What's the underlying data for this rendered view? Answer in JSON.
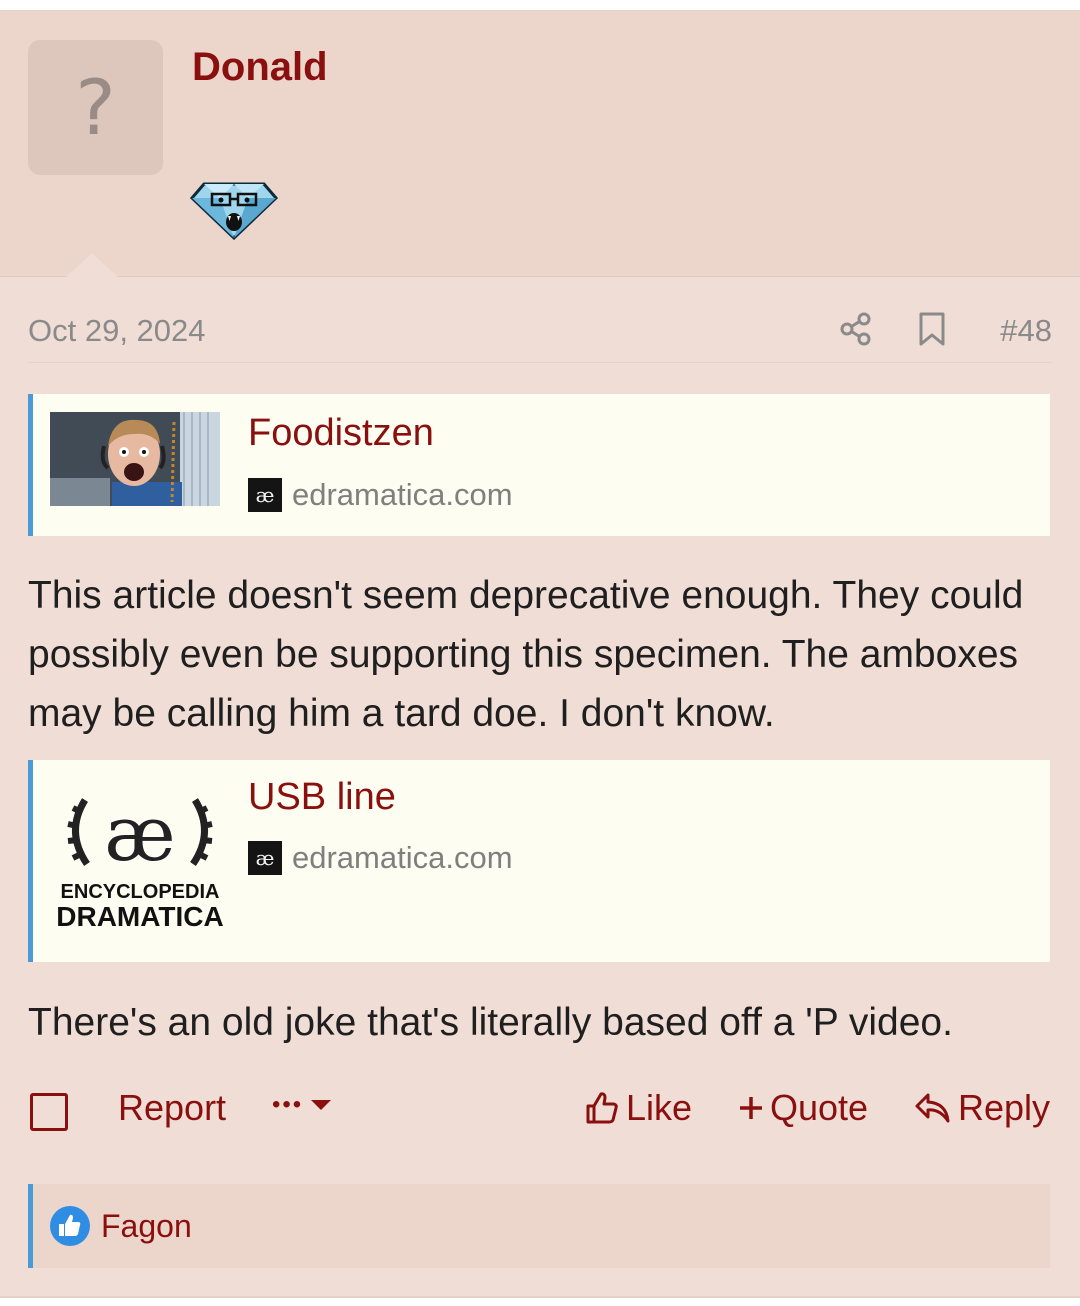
{
  "user": {
    "name": "Donald",
    "avatar_placeholder": "?",
    "banner_icon": "diamond-face-icon"
  },
  "meta": {
    "date": "Oct 29, 2024",
    "post_number": "#48"
  },
  "embeds": [
    {
      "title": "Foodistzen",
      "source": "edramatica.com",
      "favicon_text": "æ"
    },
    {
      "title": "USB line",
      "source": "edramatica.com",
      "favicon_text": "æ",
      "thumb_logo_text": "æ",
      "thumb_line1": "ENCYCLOPEDIA",
      "thumb_line2": "DRAMATICA"
    }
  ],
  "body": {
    "paragraph1": "This article doesn't seem deprecative enough. They could possibly even be supporting this specimen. The amboxes may be calling him a tard doe. I don't know.",
    "paragraph2": "There's an old joke that's literally based off a 'P video."
  },
  "actions": {
    "report": "Report",
    "more": "•••",
    "like": "Like",
    "quote": "Quote",
    "reply": "Reply"
  },
  "reactions": {
    "users": "Fagon"
  },
  "colors": {
    "accent": "#8a0f0f",
    "quote_border": "#4a9ad8",
    "user_bar_bg": "#ecd5ca",
    "post_bg": "#f0ded6",
    "embed_bg": "#fdfdf1"
  }
}
